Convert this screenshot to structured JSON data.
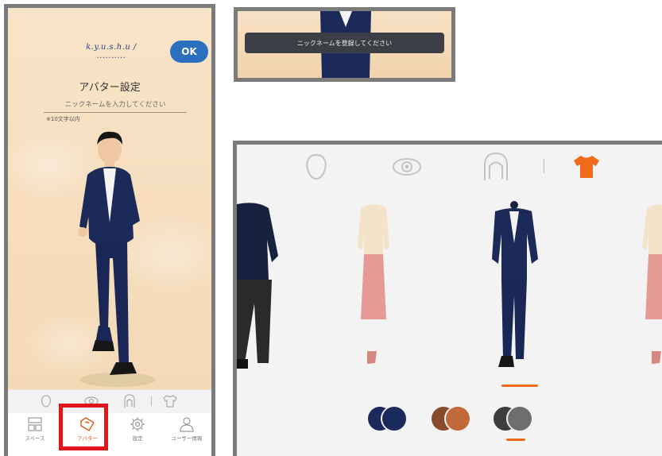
{
  "phone": {
    "logo_text": "k.y.u.s.h.u / ..........",
    "ok_label": "OK",
    "title": "アバター設定",
    "nickname_placeholder": "ニックネームを入力してください",
    "char_limit_note": "※10文字以内",
    "nav": [
      {
        "label": "スペース",
        "icon": "space-icon"
      },
      {
        "label": "アバター",
        "icon": "avatar-hanger-icon",
        "active": true
      },
      {
        "label": "設定",
        "icon": "gear-icon"
      },
      {
        "label": "ユーザー情報",
        "icon": "user-icon"
      }
    ]
  },
  "toast": {
    "message": "ニックネームを登録してください"
  },
  "outfit": {
    "categories": [
      "face-shape-icon",
      "eye-icon",
      "hair-icon",
      "clothing-icon"
    ],
    "selected_category": "clothing-icon",
    "selected_outfit_index": 2,
    "color_options": [
      {
        "name": "navy",
        "colors": [
          "#1b2a5c",
          "#1b2a5c"
        ]
      },
      {
        "name": "brown",
        "colors": [
          "#8a4a2c",
          "#c06a3a"
        ]
      },
      {
        "name": "gray",
        "colors": [
          "#3d3d3d",
          "#6e6e6e"
        ]
      }
    ],
    "selected_color_index": 2,
    "accent_color": "#f06a1d"
  }
}
